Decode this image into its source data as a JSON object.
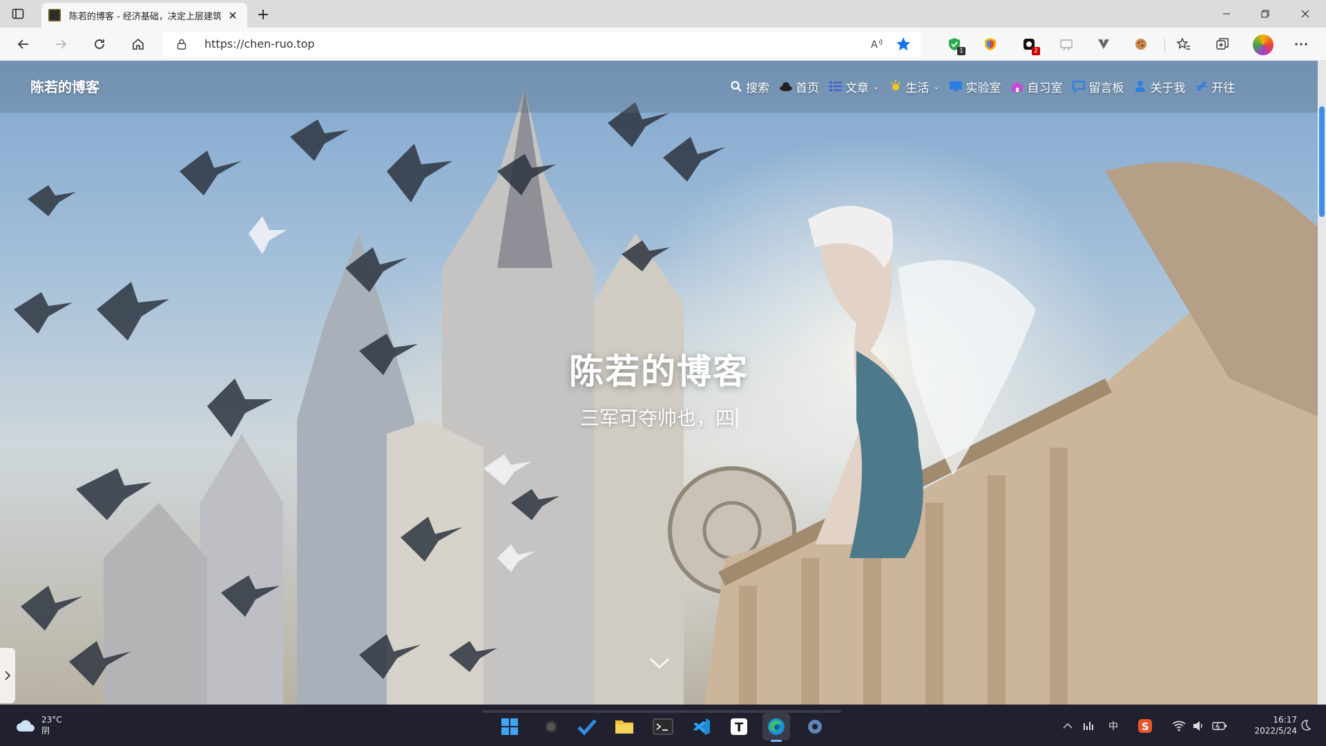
{
  "browser": {
    "tab_title": "陈若的博客 - 经济基础，决定上层建筑",
    "tab_close": "✕",
    "new_tab": "+",
    "url": "https://chen-ruo.top",
    "read_aloud": "A⁰",
    "extension_badges": {
      "shield": "1",
      "red": "2"
    }
  },
  "site": {
    "brand": "陈若的博客",
    "menu": [
      {
        "label": "搜索",
        "icon": "search-icon"
      },
      {
        "label": "首页",
        "icon": "home-hat-icon"
      },
      {
        "label": "文章",
        "icon": "list-icon",
        "dropdown": true
      },
      {
        "label": "生活",
        "icon": "sun-icon",
        "dropdown": true
      },
      {
        "label": "实验室",
        "icon": "monitor-icon"
      },
      {
        "label": "自习室",
        "icon": "house-icon"
      },
      {
        "label": "留言板",
        "icon": "chat-icon"
      },
      {
        "label": "关于我",
        "icon": "person-icon"
      },
      {
        "label": "开往",
        "icon": "train-icon"
      }
    ],
    "caret": "⌄",
    "hero_title": "陈若的博客",
    "hero_subtitle": "三军可夺帅也，四"
  },
  "taskbar": {
    "weather_temp": "23°C",
    "weather_desc": "阴",
    "ime": "中",
    "time": "16:17",
    "date": "2022/5/24",
    "apps": [
      "start-icon",
      "search-icon",
      "todo-icon",
      "file-explorer-icon",
      "terminal-icon",
      "vscode-icon",
      "typora-icon",
      "edge-icon",
      "settings-icon"
    ]
  },
  "colors": {
    "accent": "#3d8ee6",
    "taskbar": "#20202e",
    "star": "#1a73e8"
  }
}
